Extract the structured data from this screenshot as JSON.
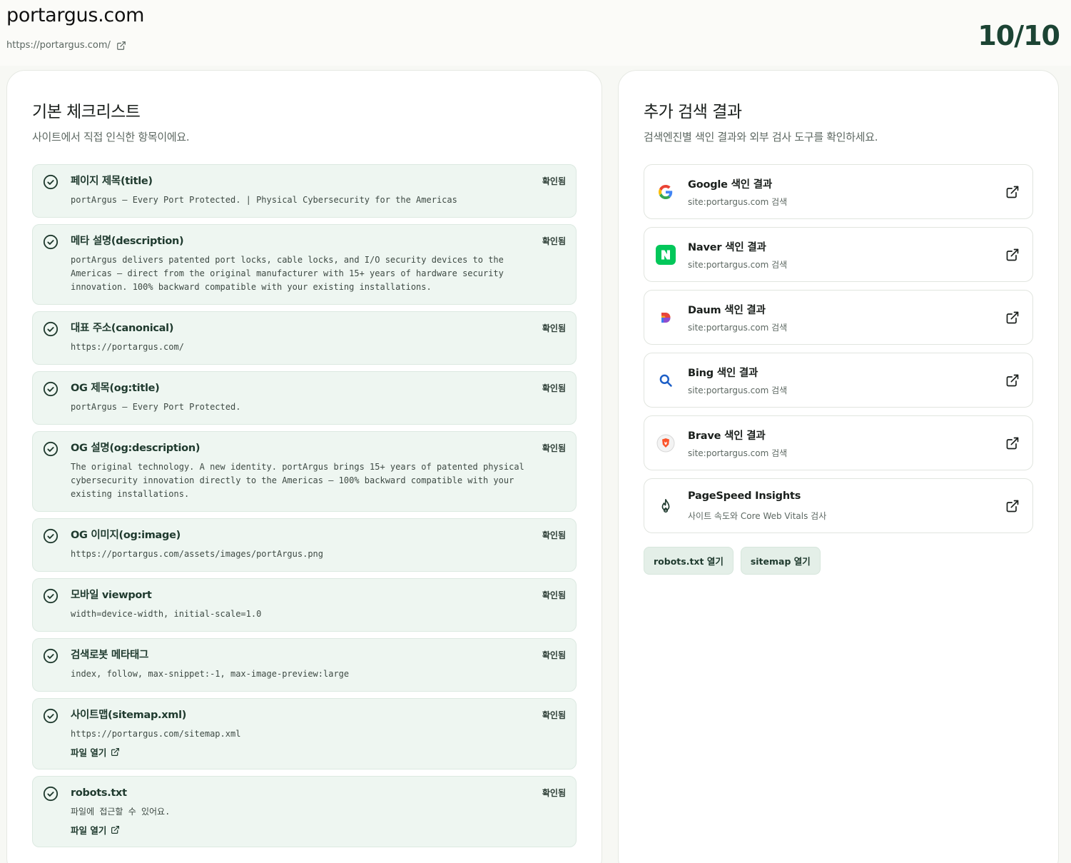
{
  "header": {
    "site_title": "portargus.com",
    "site_url": "https://portargus.com/",
    "score": "10/10"
  },
  "left_panel": {
    "title": "기본 체크리스트",
    "subtitle": "사이트에서 직접 인식한 항목이에요.",
    "items": [
      {
        "label": "페이지 제목(title)",
        "status": "확인됨",
        "value": "portArgus — Every Port Protected. | Physical Cybersecurity for the Americas"
      },
      {
        "label": "메타 설명(description)",
        "status": "확인됨",
        "value": "portArgus delivers patented port locks, cable locks, and I/O security devices to the Americas — direct from the original manufacturer with 15+ years of hardware security innovation. 100% backward compatible with your existing installations."
      },
      {
        "label": "대표 주소(canonical)",
        "status": "확인됨",
        "value": "https://portargus.com/"
      },
      {
        "label": "OG 제목(og:title)",
        "status": "확인됨",
        "value": "portArgus — Every Port Protected."
      },
      {
        "label": "OG 설명(og:description)",
        "status": "확인됨",
        "value": "The original technology. A new identity. portArgus brings 15+ years of patented physical cybersecurity innovation directly to the Americas — 100% backward compatible with your existing installations."
      },
      {
        "label": "OG 이미지(og:image)",
        "status": "확인됨",
        "value": "https://portargus.com/assets/images/portArgus.png"
      },
      {
        "label": "모바일 viewport",
        "status": "확인됨",
        "value": "width=device-width, initial-scale=1.0"
      },
      {
        "label": "검색로봇 메타태그",
        "status": "확인됨",
        "value": "index, follow, max-snippet:-1, max-image-preview:large"
      },
      {
        "label": "사이트맵(sitemap.xml)",
        "status": "확인됨",
        "value": "https://portargus.com/sitemap.xml",
        "link": "파일 열기"
      },
      {
        "label": "robots.txt",
        "status": "확인됨",
        "value": "파일에 접근할 수 있어요.",
        "link": "파일 열기"
      }
    ]
  },
  "right_panel": {
    "title": "추가 검색 결과",
    "subtitle": "검색엔진별 색인 결과와 외부 검사 도구를 확인하세요.",
    "engines": [
      {
        "name": "Google 색인 결과",
        "query": "site:portargus.com 검색",
        "icon": "google-logo-icon"
      },
      {
        "name": "Naver 색인 결과",
        "query": "site:portargus.com 검색",
        "icon": "naver-logo-icon"
      },
      {
        "name": "Daum 색인 결과",
        "query": "site:portargus.com 검색",
        "icon": "daum-logo-icon"
      },
      {
        "name": "Bing 색인 결과",
        "query": "site:portargus.com 검색",
        "icon": "bing-search-icon"
      },
      {
        "name": "Brave 색인 결과",
        "query": "site:portargus.com 검색",
        "icon": "brave-logo-icon"
      },
      {
        "name": "PageSpeed Insights",
        "query": "사이트 속도와 Core Web Vitals 검사",
        "icon": "pagespeed-icon"
      }
    ],
    "buttons": {
      "robots": "robots.txt 열기",
      "sitemap": "sitemap 열기"
    }
  },
  "colors": {
    "accent": "#1c4434",
    "item_bg": "#eef6f1",
    "naver_green": "#03c75a"
  }
}
